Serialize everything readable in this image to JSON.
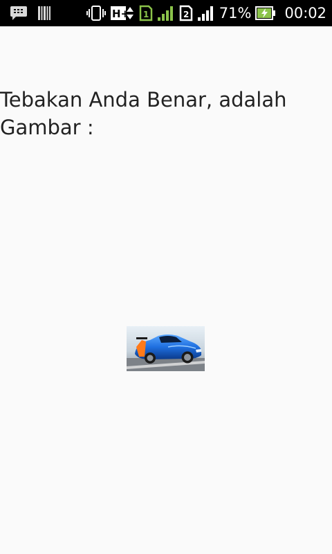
{
  "status_bar": {
    "battery_percent": "71%",
    "time": "00:02",
    "network_type": "H+",
    "sim1_label": "1",
    "sim2_label": "2",
    "icons": [
      "bbm-notification-icon",
      "barcode-notification-icon",
      "vibrate-icon",
      "hplus-data-icon",
      "sim1-icon",
      "signal-1-icon",
      "sim2-icon",
      "signal-2-icon",
      "battery-charging-icon"
    ],
    "colors": {
      "background": "#000000",
      "sim1_signal": "#8bc34a",
      "battery_charging": "#8bc34a",
      "foreground": "#ffffff"
    }
  },
  "main": {
    "message": "Tebakan Anda Benar, adalah Gambar :",
    "image": {
      "subject": "blue sports car",
      "icon": "car-image"
    }
  },
  "colors": {
    "page_background": "#fafafa",
    "text": "#222222"
  }
}
